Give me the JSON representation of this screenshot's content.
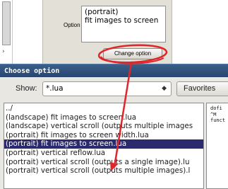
{
  "option_panel": {
    "label": "Option",
    "value_lines": [
      "(portrait)",
      "fit images to screen"
    ],
    "change_button": "Change option"
  },
  "chooser": {
    "title": "Choose option",
    "show_label": "Show:",
    "filter_value": "*.lua",
    "favorites_label": "Favorites",
    "files": [
      "../",
      "(landscape) fit images to screen.lua",
      "(landscape) vertical scroll (outputs multiple images",
      "(portrait) fit images to screen width.lua",
      "(portrait) fit images to screen.lua",
      "(portrait) vertical reflow.lua",
      "(portrait) vertical scroll (outputs a single image).lu",
      "(portrait) vertical scroll (outputs multiple images).l"
    ],
    "selected_index": 4,
    "preview_lines": [
      "dofi",
      "^M",
      "funct"
    ]
  },
  "annotation": {
    "color": "#e0262a"
  }
}
